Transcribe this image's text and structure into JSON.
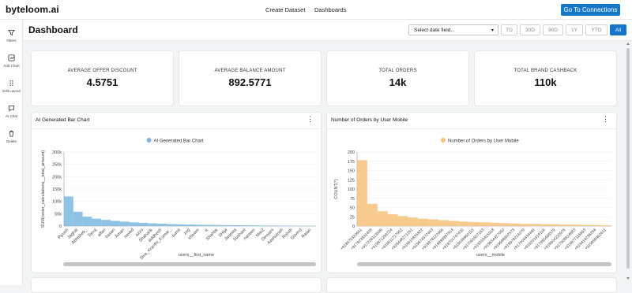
{
  "app": {
    "brand": "byteloom.ai"
  },
  "nav": {
    "create_dataset": "Create Dataset",
    "dashboards": "Dashboards",
    "go_to_connections": "Go To Connections"
  },
  "sidebar": {
    "items": [
      {
        "label": "Filters",
        "icon": "filter-icon"
      },
      {
        "label": "Add Chart",
        "icon": "add-chart-icon"
      },
      {
        "label": "Edit Layout",
        "icon": "drag-grid-icon"
      },
      {
        "label": "AI Chat",
        "icon": "chat-icon"
      },
      {
        "label": "Delete",
        "icon": "trash-icon"
      }
    ]
  },
  "header": {
    "title": "Dashboard",
    "date_select_placeholder": "Select date field...",
    "ranges": [
      "TD",
      "30D",
      "90D",
      "1Y",
      "YTD",
      "All"
    ],
    "active_range": "All"
  },
  "kpis": [
    {
      "label": "AVERAGE OFFER DISCOUNT",
      "value": "4.5751"
    },
    {
      "label": "AVERAGE BALANCE AMOUNT",
      "value": "892.5771"
    },
    {
      "label": "TOTAL ORDERS",
      "value": "14k"
    },
    {
      "label": "TOTAL BRAND CASHBACK",
      "value": "110k"
    }
  ],
  "colors": {
    "accent": "#1677c8",
    "bar_blue": "#7ab8e0",
    "bar_orange": "#f6c27a"
  },
  "chart_data": [
    {
      "type": "bar",
      "card_title": "AI Generated Bar Chart",
      "legend": "AI Generated Bar Chart",
      "legend_position": "top-center",
      "xlabel": "users__first_name",
      "ylabel": "SUM(order_calculations__total_amount)",
      "ylim": [
        0,
        300000
      ],
      "yticks": [
        "0",
        "50k",
        "100k",
        "150k",
        "200k",
        "250k",
        "300k"
      ],
      "grid": true,
      "categories": [
        "Piyush",
        "Jaghal",
        "Abhishek_",
        "Tanuj",
        "affan",
        "hasan",
        "Aman",
        "naved",
        "azzu",
        "Shahank",
        "siddhesh",
        "Siva_Kranthi_Kumar_",
        "sumit",
        "zog",
        "shivam",
        "K",
        "Shahbk",
        "SHija",
        "Jasmita",
        "Sushant",
        "naveen",
        "MarZ",
        "Devyani",
        "Aashutosh",
        "Rohith",
        "Govind",
        "Ratan"
      ],
      "values": [
        120000,
        58000,
        38000,
        30000,
        25000,
        21000,
        18000,
        15000,
        13000,
        11000,
        9500,
        8000,
        7000,
        6200,
        5400,
        4800,
        4200,
        3700,
        3300,
        2900,
        2500,
        2200,
        1900,
        1600,
        1300,
        1000,
        700
      ]
    },
    {
      "type": "bar",
      "card_title": "Number of Orders by User Mobile",
      "legend": "Number of Orders by User Mobile",
      "legend_position": "top-center",
      "xlabel": "users__mobile",
      "ylabel": "COUNT(*)",
      "ylim": [
        0,
        200
      ],
      "yticks": [
        "0",
        "25",
        "50",
        "75",
        "100",
        "125",
        "150",
        "175",
        "200"
      ],
      "grid": true,
      "categories": [
        "+918575320651",
        "+917823931408",
        "+917208113596",
        "+919871288724",
        "+919811727952",
        "+918448271251",
        "+919910835822",
        "+919874572443",
        "+918978122466",
        "+918989987814",
        "+918701747430",
        "+919039960110",
        "+917060507163",
        "+918333415918",
        "+919654427050",
        "+919998902573",
        "+919978214279",
        "+917004434449",
        "+916201619116",
        "+917985468579",
        "+918604220976",
        "+917908824683",
        "+919977116693",
        "+919414236284",
        "+919958462611"
      ],
      "values": [
        178,
        60,
        40,
        32,
        27,
        23,
        20,
        18,
        16,
        14,
        12,
        11,
        10,
        9,
        8,
        7,
        6,
        6,
        5,
        5,
        4,
        4,
        3,
        3,
        2
      ]
    }
  ]
}
